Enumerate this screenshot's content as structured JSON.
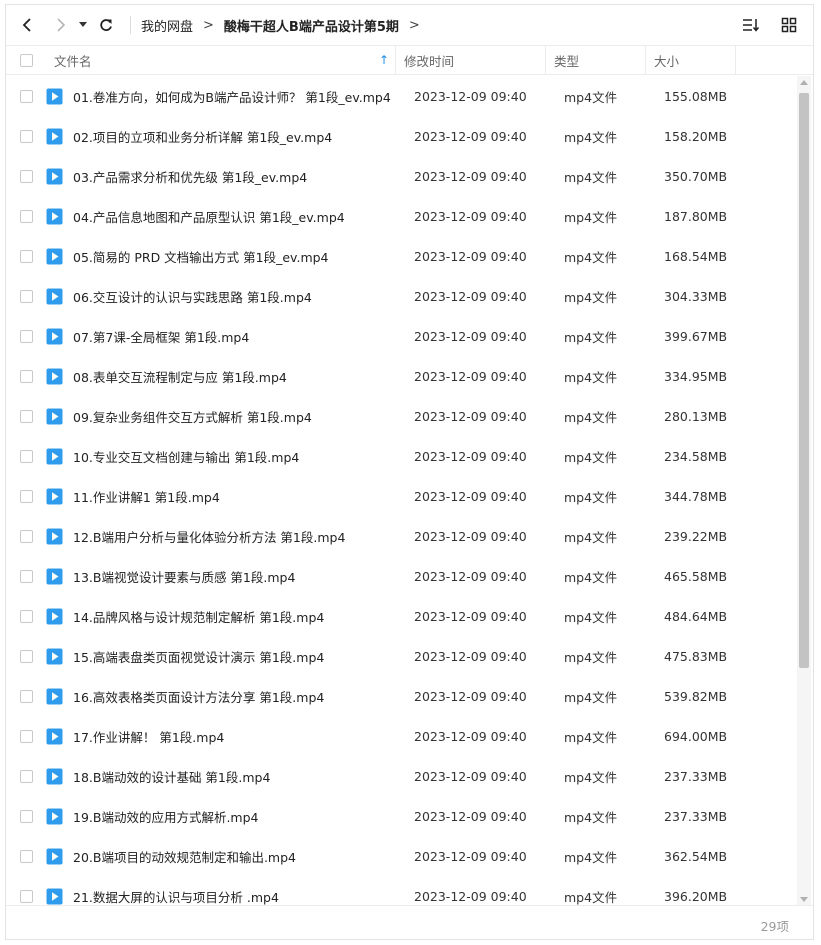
{
  "breadcrumb": {
    "root": "我的网盘",
    "separator": ">",
    "current": "酸梅干超人B端产品设计第5期",
    "trailing_arrow": ">"
  },
  "toolbar": {
    "icons": [
      "back-icon",
      "forward-icon",
      "history-dropdown-icon",
      "refresh-icon",
      "sort-list-icon",
      "grid-view-icon"
    ]
  },
  "table": {
    "headers": {
      "name": "文件名",
      "modified": "修改时间",
      "type": "类型",
      "size": "大小"
    },
    "sort_indicator": "↑",
    "accent_color": "#1f8fe6",
    "rows": [
      {
        "name": "01.卷准方向，如何成为B端产品设计师？ 第1段_ev.mp4",
        "modified": "2023-12-09 09:40",
        "type": "mp4文件",
        "size": "155.08MB"
      },
      {
        "name": "02.项目的立项和业务分析详解 第1段_ev.mp4",
        "modified": "2023-12-09 09:40",
        "type": "mp4文件",
        "size": "158.20MB"
      },
      {
        "name": "03.产品需求分析和优先级 第1段_ev.mp4",
        "modified": "2023-12-09 09:40",
        "type": "mp4文件",
        "size": "350.70MB"
      },
      {
        "name": "04.产品信息地图和产品原型认识 第1段_ev.mp4",
        "modified": "2023-12-09 09:40",
        "type": "mp4文件",
        "size": "187.80MB"
      },
      {
        "name": "05.简易的 PRD 文档输出方式 第1段_ev.mp4",
        "modified": "2023-12-09 09:40",
        "type": "mp4文件",
        "size": "168.54MB"
      },
      {
        "name": "06.交互设计的认识与实践思路 第1段.mp4",
        "modified": "2023-12-09 09:40",
        "type": "mp4文件",
        "size": "304.33MB"
      },
      {
        "name": "07.第7课-全局框架 第1段.mp4",
        "modified": "2023-12-09 09:40",
        "type": "mp4文件",
        "size": "399.67MB"
      },
      {
        "name": "08.表单交互流程制定与应 第1段.mp4",
        "modified": "2023-12-09 09:40",
        "type": "mp4文件",
        "size": "334.95MB"
      },
      {
        "name": "09.复杂业务组件交互方式解析 第1段.mp4",
        "modified": "2023-12-09 09:40",
        "type": "mp4文件",
        "size": "280.13MB"
      },
      {
        "name": "10.专业交互文档创建与输出 第1段.mp4",
        "modified": "2023-12-09 09:40",
        "type": "mp4文件",
        "size": "234.58MB"
      },
      {
        "name": "11.作业讲解1 第1段.mp4",
        "modified": "2023-12-09 09:40",
        "type": "mp4文件",
        "size": "344.78MB"
      },
      {
        "name": "12.B端用户分析与量化体验分析方法 第1段.mp4",
        "modified": "2023-12-09 09:40",
        "type": "mp4文件",
        "size": "239.22MB"
      },
      {
        "name": "13.B端视觉设计要素与质感 第1段.mp4",
        "modified": "2023-12-09 09:40",
        "type": "mp4文件",
        "size": "465.58MB"
      },
      {
        "name": "14.品牌风格与设计规范制定解析 第1段.mp4",
        "modified": "2023-12-09 09:40",
        "type": "mp4文件",
        "size": "484.64MB"
      },
      {
        "name": "15.高端表盘类页面视觉设计演示 第1段.mp4",
        "modified": "2023-12-09 09:40",
        "type": "mp4文件",
        "size": "475.83MB"
      },
      {
        "name": "16.高效表格类页面设计方法分享 第1段.mp4",
        "modified": "2023-12-09 09:40",
        "type": "mp4文件",
        "size": "539.82MB"
      },
      {
        "name": "17.作业讲解！ 第1段.mp4",
        "modified": "2023-12-09 09:40",
        "type": "mp4文件",
        "size": "694.00MB"
      },
      {
        "name": "18.B端动效的设计基础 第1段.mp4",
        "modified": "2023-12-09 09:40",
        "type": "mp4文件",
        "size": "237.33MB"
      },
      {
        "name": "19.B端动效的应用方式解析.mp4",
        "modified": "2023-12-09 09:40",
        "type": "mp4文件",
        "size": "237.33MB"
      },
      {
        "name": "20.B端项目的动效规范制定和输出.mp4",
        "modified": "2023-12-09 09:40",
        "type": "mp4文件",
        "size": "362.54MB"
      },
      {
        "name": "21.数据大屏的认识与项目分析 .mp4",
        "modified": "2023-12-09 09:40",
        "type": "mp4文件",
        "size": "396.20MB"
      }
    ]
  },
  "footer": {
    "item_count": "29项"
  },
  "file_icon": {
    "name": "video-file-icon",
    "color": "#2f9bec"
  }
}
